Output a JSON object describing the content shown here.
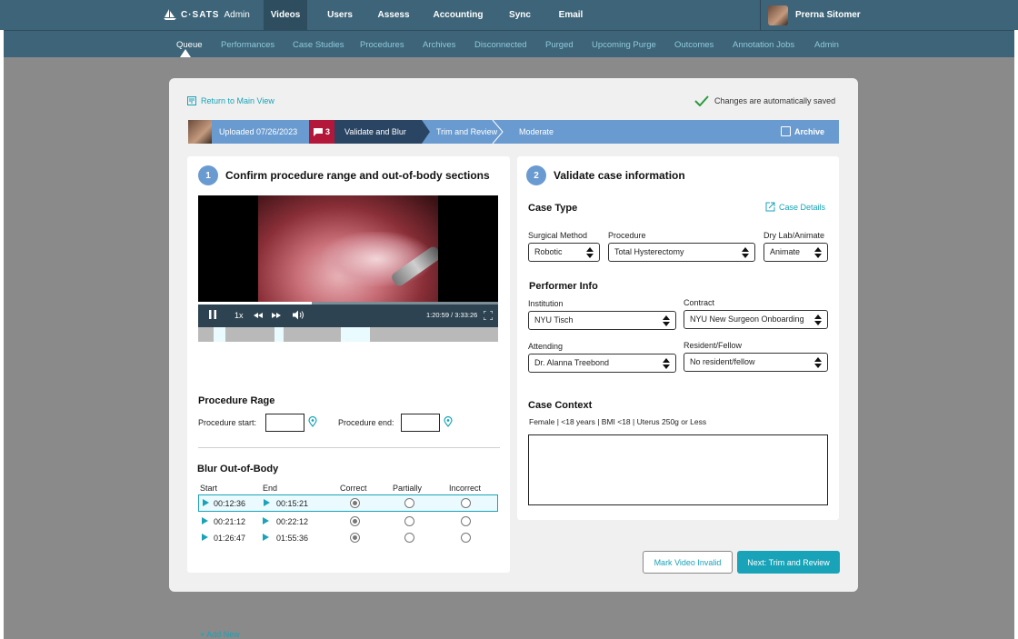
{
  "brand": {
    "name": "C·SATS",
    "suffix": "Admin"
  },
  "topnav": [
    "Videos",
    "Users",
    "Assess",
    "Accounting",
    "Sync",
    "Email"
  ],
  "user": {
    "name": "Prerna Sitomer"
  },
  "subnav": [
    "Queue",
    "Performances",
    "Case Studies",
    "Procedures",
    "Archives",
    "Disconnected",
    "Purged",
    "Upcoming Purge",
    "Outcomes",
    "Annotation Jobs",
    "Admin"
  ],
  "modal": {
    "return_label": "Return to Main View",
    "saved_label": "Changes are automatically saved",
    "steps": {
      "uploaded": "Uploaded 07/26/2023",
      "comments": "3",
      "validate": "Validate and Blur",
      "trim": "Trim and Review",
      "moderate": "Moderate",
      "archive": "Archive"
    },
    "left": {
      "num": "1",
      "title": "Confirm procedure range and out-of-body sections",
      "player": {
        "speed": "1x",
        "time": "1:20:59 / 3:33:26",
        "progress": 0.38
      },
      "range_title": "Procedure Rage",
      "start_label": "Procedure start:",
      "end_label": "Procedure end:",
      "blur_title": "Blur Out-of-Body",
      "cols": {
        "start": "Start",
        "end": "End",
        "correct": "Correct",
        "partially": "Partially",
        "incorrect": "Incorrect"
      },
      "rows": [
        {
          "start": "00:12:36",
          "end": "00:15:21",
          "selected": "correct"
        },
        {
          "start": "00:21:12",
          "end": "00:22:12",
          "selected": "correct"
        },
        {
          "start": "01:26:47",
          "end": "01:55:36",
          "selected": "correct"
        }
      ],
      "add_new": "+ Add New"
    },
    "right": {
      "num": "2",
      "title": "Validate case information",
      "case_type": "Case Type",
      "case_details": "Case Details",
      "surgical_method": {
        "label": "Surgical Method",
        "value": "Robotic"
      },
      "procedure": {
        "label": "Procedure",
        "value": "Total Hysterectomy"
      },
      "drylab": {
        "label": "Dry Lab/Animate",
        "value": "Animate"
      },
      "performer": "Performer Info",
      "institution": {
        "label": "Institution",
        "value": "NYU Tisch"
      },
      "contract": {
        "label": "Contract",
        "value": "NYU New Surgeon Onboarding"
      },
      "attending": {
        "label": "Attending",
        "value": "Dr. Alanna Treebond"
      },
      "resident": {
        "label": "Resident/Fellow",
        "value": "No resident/fellow"
      },
      "context_title": "Case Context",
      "context_text": "Female | <18 years | BMI <18 | Uterus 250g or Less"
    },
    "buttons": {
      "invalid": "Mark Video Invalid",
      "next": "Next:  Trim and Review"
    }
  },
  "colors": {
    "nav": "#3d6478",
    "accent": "#19a3b8",
    "step_active": "#2a4563",
    "step_bar": "#6a9bd0",
    "badge": "#b3183a"
  }
}
